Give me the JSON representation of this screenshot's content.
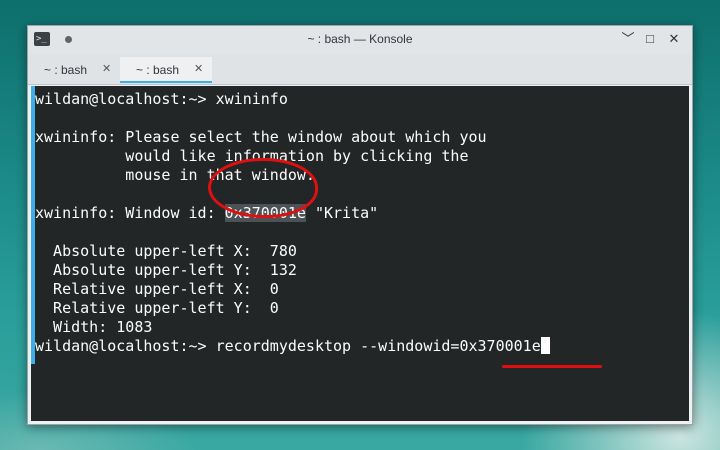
{
  "window": {
    "title": "~ : bash — Konsole",
    "app_icon_glyph": ">_",
    "controls": {
      "minimize": "﹀",
      "maximize": "□",
      "close": "✕"
    }
  },
  "tabs": [
    {
      "label": "~ : bash",
      "close": "✕",
      "active": false
    },
    {
      "label": "~ : bash",
      "close": "✕",
      "active": true
    }
  ],
  "terminal": {
    "prompt": "wildan@localhost:~>",
    "command_1": "xwininfo",
    "msg_line1": "xwininfo: Please select the window about which you",
    "msg_line2": "          would like information by clicking the",
    "msg_line3": "          mouse in that window.",
    "window_id_prefix": "xwininfo: Window id: ",
    "window_id": "0x370001e",
    "window_name": "\"Krita\"",
    "info_1": "  Absolute upper-left X:  780",
    "info_2": "  Absolute upper-left Y:  132",
    "info_3": "  Relative upper-left X:  0",
    "info_4": "  Relative upper-left Y:  0",
    "info_5": "  Width: 1083",
    "command_2": "recordmydesktop --windowid=0x370001e"
  },
  "colors": {
    "terminal_bg": "#232627",
    "terminal_fg": "#fcfcfc",
    "accent": "#3daee9",
    "annotation": "#e01010"
  }
}
